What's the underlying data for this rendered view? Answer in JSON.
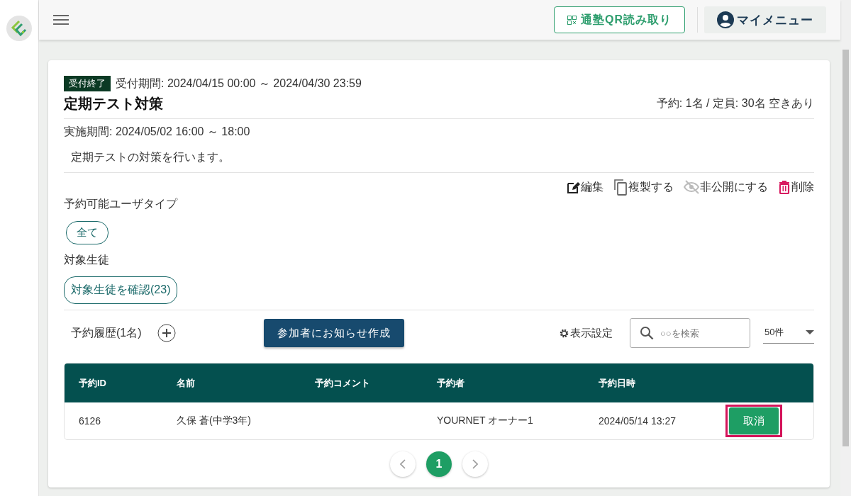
{
  "header": {
    "qr_button": "通塾QR読み取り",
    "menu_button": "マイメニュー"
  },
  "event": {
    "status_badge": "受付終了",
    "reception_period": "受付期間: 2024/04/15 00:00 ～ 2024/04/30 23:59",
    "title": "定期テスト対策",
    "capacity": "予約: 1名 / 定員: 30名 空きあり",
    "schedule": "実施期間: 2024/05/02 16:00 ～ 18:00",
    "description": "定期テストの対策を行います。",
    "actions": [
      {
        "kind": "edit",
        "label": "編集"
      },
      {
        "kind": "copy",
        "label": "複製する"
      },
      {
        "kind": "hide",
        "label": "非公開にする"
      },
      {
        "kind": "delete",
        "label": "削除"
      }
    ],
    "user_types_label": "予約可能ユーザタイプ",
    "user_types": [
      "全て"
    ],
    "students_label": "対象生徒",
    "students_button": "対象生徒を確認(23)"
  },
  "reservations": {
    "heading": "予約履歴(1名)",
    "notify_button": "参加者にお知らせ作成",
    "display_settings": "表示設定",
    "search": {
      "placeholder": "○○を検索"
    },
    "page_size": "50件",
    "columns": [
      "予約ID",
      "名前",
      "予約コメント",
      "予約者",
      "予約日時"
    ],
    "rows": [
      {
        "id": "6126",
        "name": "久保 蒼(中学3年)",
        "booker": "YOURNET オーナー1",
        "datetime": "2024/05/14 13:27",
        "action": "取消",
        "highlighted": true
      }
    ],
    "pages": [
      {
        "label": "1",
        "selected": true
      }
    ]
  }
}
